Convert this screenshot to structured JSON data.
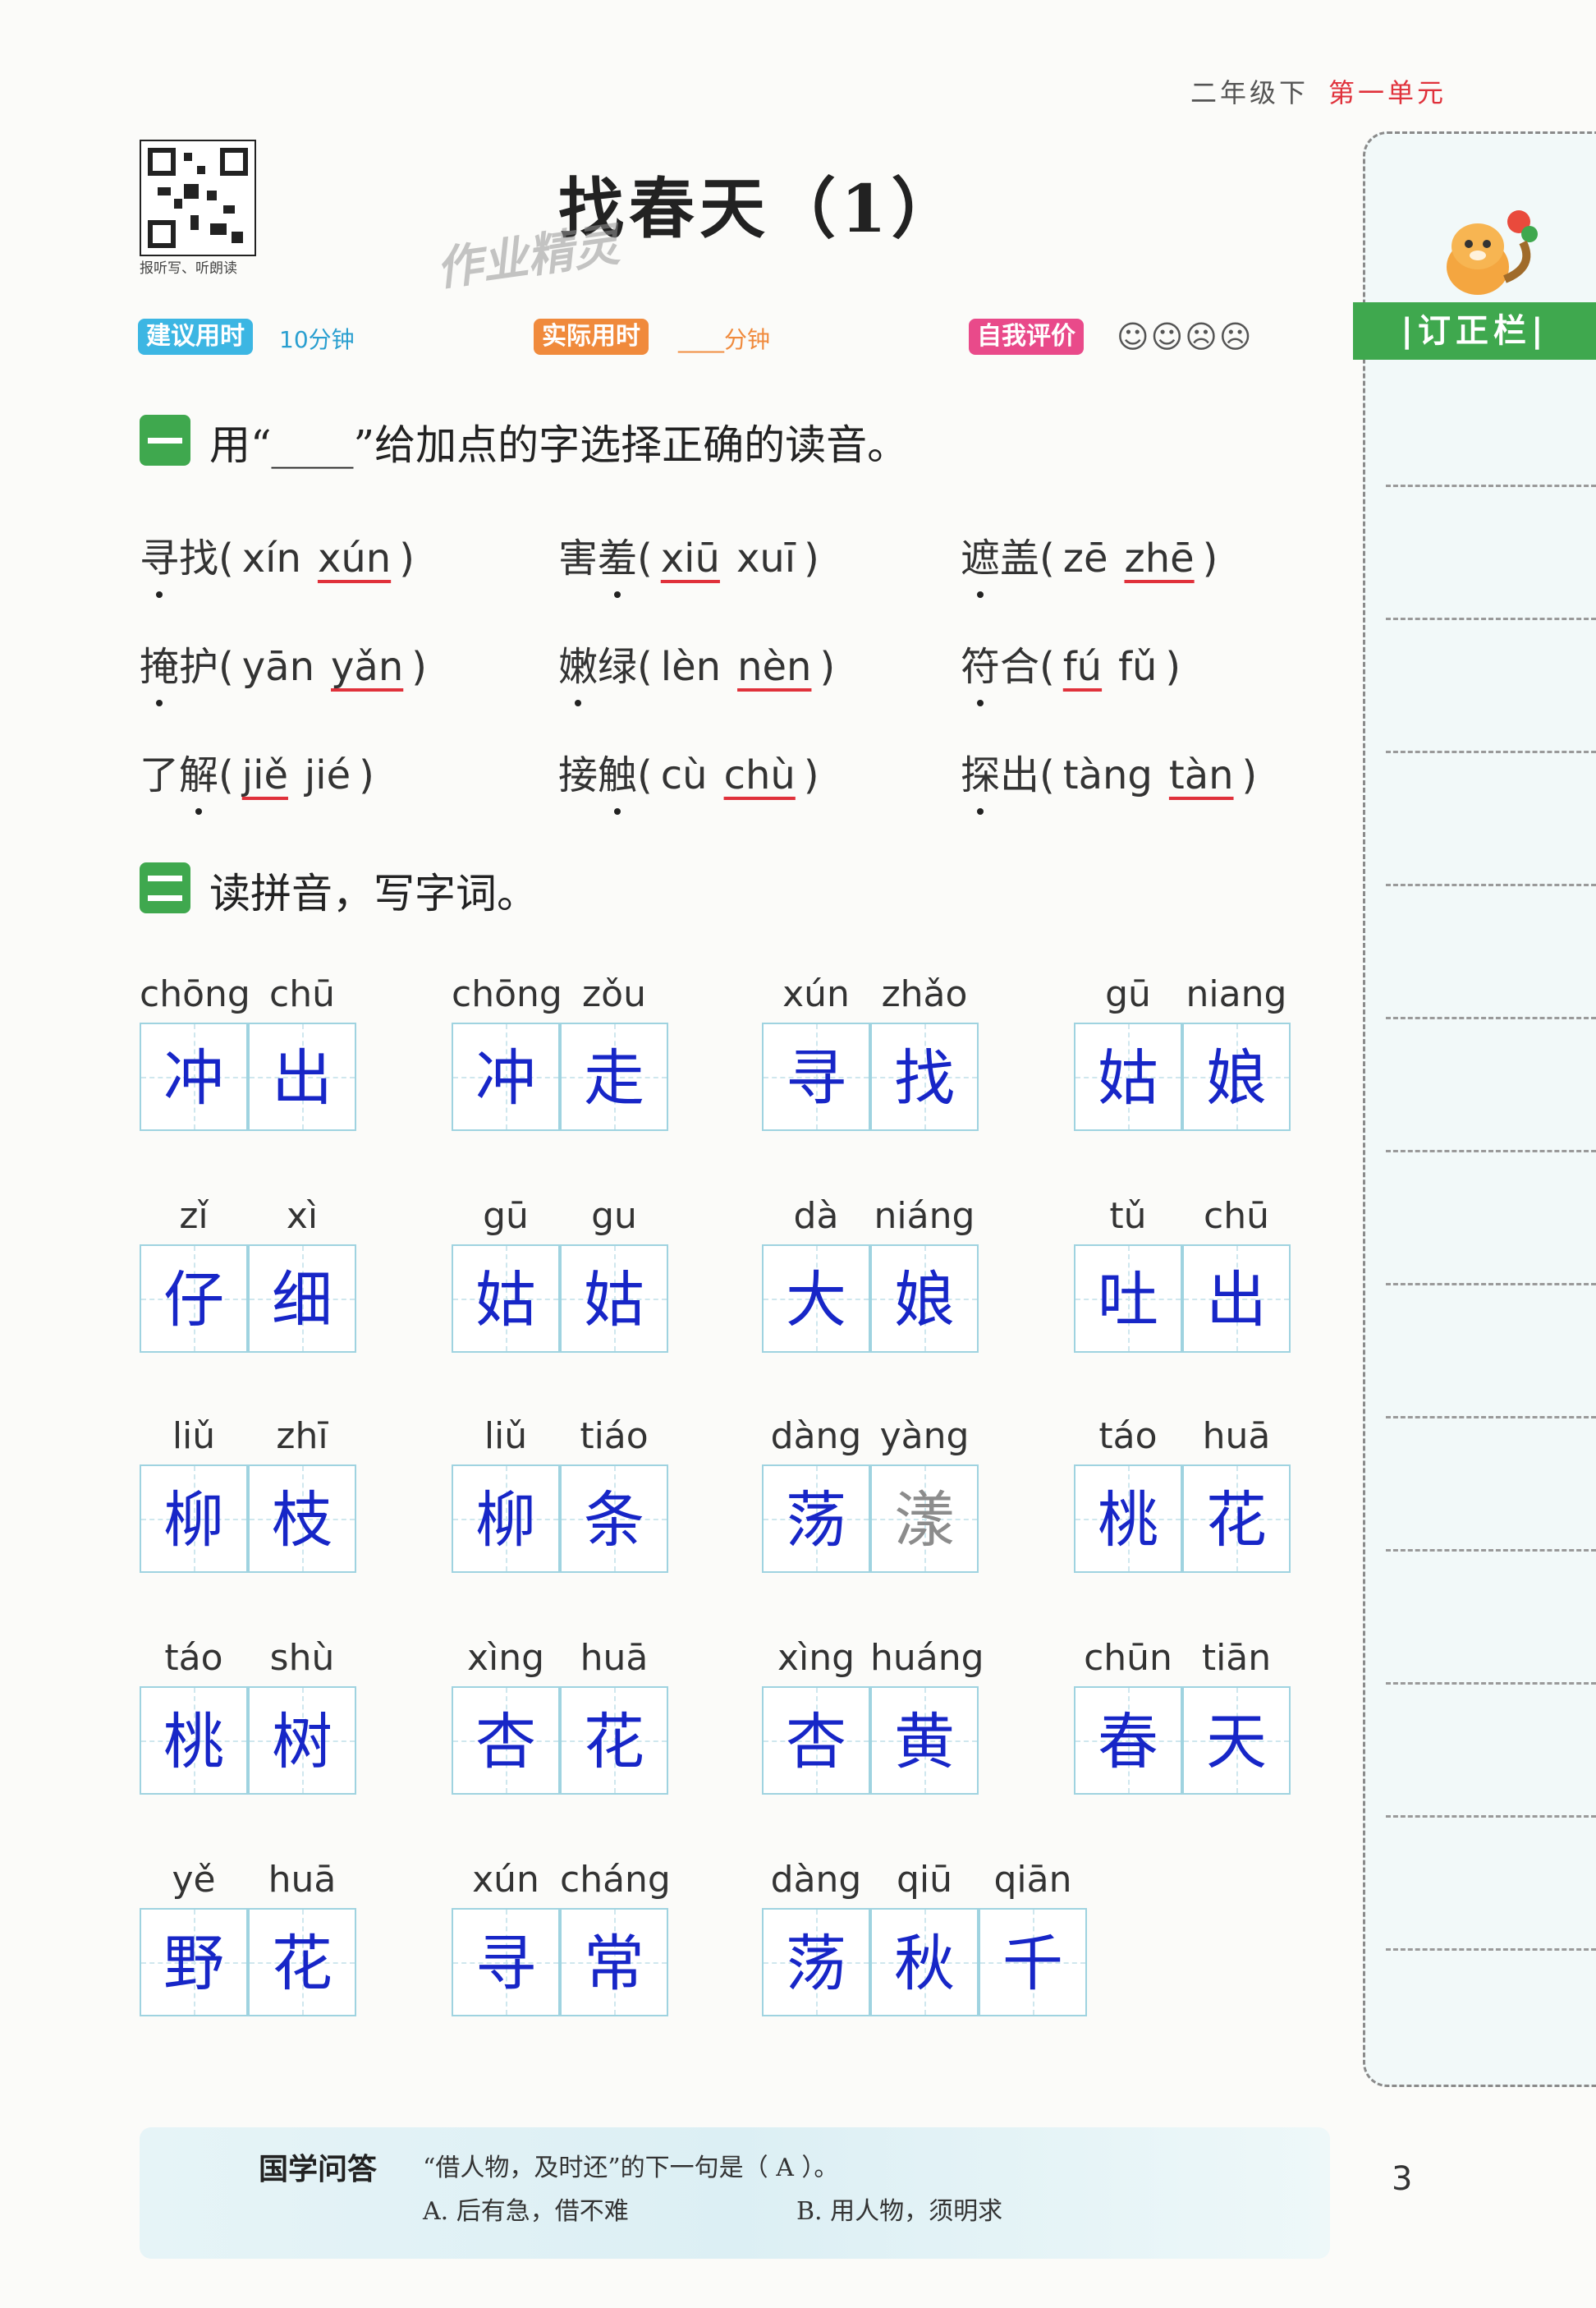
{
  "header": {
    "grade": "二年级下",
    "unit": "第一单元"
  },
  "qr_caption": "报听写、听朗读",
  "title": "找春天（1）",
  "watermark": "作业精灵",
  "timing": {
    "suggested_label": "建议用时",
    "suggested_value": "10分钟",
    "actual_label": "实际用时",
    "actual_value": "____分钟",
    "self_label": "自我评价",
    "faces": "☺☺☹☹"
  },
  "sidebar": {
    "tab": "|订正栏|"
  },
  "section1": {
    "prompt": "用“____”给加点的字选择正确的读音。",
    "items": [
      {
        "word": "寻找",
        "dot": 0,
        "a": "xín",
        "b": "xún",
        "ans": "b"
      },
      {
        "word": "害羞",
        "dot": 1,
        "a": "xiū",
        "b": "xuī",
        "ans": "a"
      },
      {
        "word": "遮盖",
        "dot": 0,
        "a": "zē",
        "b": "zhē",
        "ans": "b"
      },
      {
        "word": "掩护",
        "dot": 0,
        "a": "yān",
        "b": "yǎn",
        "ans": "b"
      },
      {
        "word": "嫩绿",
        "dot": 0,
        "a": "lèn",
        "b": "nèn",
        "ans": "b"
      },
      {
        "word": "符合",
        "dot": 0,
        "a": "fú",
        "b": "fǔ",
        "ans": "a"
      },
      {
        "word": "了解",
        "dot": 1,
        "a": "jiě",
        "b": "jié",
        "ans": "a"
      },
      {
        "word": "接触",
        "dot": 1,
        "a": "cù",
        "b": "chù",
        "ans": "b"
      },
      {
        "word": "探出",
        "dot": 0,
        "a": "tàng",
        "b": "tàn",
        "ans": "b"
      }
    ]
  },
  "section2": {
    "prompt": "读拼音，写字词。",
    "words": [
      {
        "py": [
          "chōng",
          "chū"
        ],
        "hz": [
          "冲",
          "出"
        ]
      },
      {
        "py": [
          "chōng",
          "zǒu"
        ],
        "hz": [
          "冲",
          "走"
        ]
      },
      {
        "py": [
          "xún",
          "zhǎo"
        ],
        "hz": [
          "寻",
          "找"
        ]
      },
      {
        "py": [
          "gū",
          "niang"
        ],
        "hz": [
          "姑",
          "娘"
        ]
      },
      {
        "py": [
          "zǐ",
          "xì"
        ],
        "hz": [
          "仔",
          "细"
        ]
      },
      {
        "py": [
          "gū",
          "gu"
        ],
        "hz": [
          "姑",
          "姑"
        ]
      },
      {
        "py": [
          "dà",
          "niáng"
        ],
        "hz": [
          "大",
          "娘"
        ]
      },
      {
        "py": [
          "tǔ",
          "chū"
        ],
        "hz": [
          "吐",
          "出"
        ]
      },
      {
        "py": [
          "liǔ",
          "zhī"
        ],
        "hz": [
          "柳",
          "枝"
        ]
      },
      {
        "py": [
          "liǔ",
          "tiáo"
        ],
        "hz": [
          "柳",
          "条"
        ]
      },
      {
        "py": [
          "dàng",
          "yàng"
        ],
        "hz": [
          "荡",
          "漾"
        ]
      },
      {
        "py": [
          "táo",
          "huā"
        ],
        "hz": [
          "桃",
          "花"
        ]
      },
      {
        "py": [
          "táo",
          "shù"
        ],
        "hz": [
          "桃",
          "树"
        ]
      },
      {
        "py": [
          "xìng",
          "huā"
        ],
        "hz": [
          "杏",
          "花"
        ]
      },
      {
        "py": [
          "xìng",
          "huáng"
        ],
        "hz": [
          "杏",
          "黄"
        ]
      },
      {
        "py": [
          "chūn",
          "tiān"
        ],
        "hz": [
          "春",
          "天"
        ]
      },
      {
        "py": [
          "yě",
          "huā"
        ],
        "hz": [
          "野",
          "花"
        ]
      },
      {
        "py": [
          "xún",
          "cháng"
        ],
        "hz": [
          "寻",
          "常"
        ]
      },
      {
        "py": [
          "dàng",
          "qiū",
          "qiān"
        ],
        "hz": [
          "荡",
          "秋",
          "千"
        ]
      }
    ]
  },
  "footer": {
    "label": "国学问答",
    "question": "“借人物，及时还”的下一句是（ A ）。",
    "option_a": "A. 后有急，借不难",
    "option_b": "B. 用人物，须明求"
  },
  "page_number": "3",
  "colors": {
    "accent_green": "#3fa84e",
    "answer_blue": "#1726c7",
    "underline_red": "#e0313b"
  }
}
